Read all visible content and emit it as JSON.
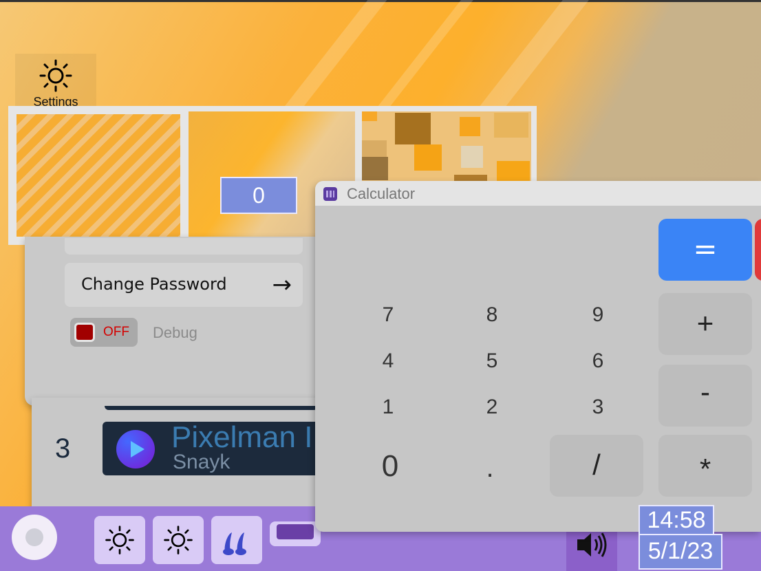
{
  "desktop": {
    "icons": [
      {
        "label": "Settings",
        "icon": "sun-gear-icon"
      }
    ]
  },
  "wallpaper_picker": {
    "counter": "0"
  },
  "settings_window": {
    "change_password_label": "Change Password",
    "change_password_arrow": "→",
    "debug_toggle_state": "OFF",
    "debug_label": "Debug"
  },
  "music_window": {
    "track_number": "3",
    "track_title": "Pixelman I",
    "track_artist": "Snayk"
  },
  "calculator": {
    "title": "Calculator",
    "keys": {
      "equals": "=",
      "plus": "+",
      "minus": "-",
      "multiply": "*",
      "divide": "/",
      "decimal": ".",
      "zero": "0",
      "one": "1",
      "two": "2",
      "three": "3",
      "four": "4",
      "five": "5",
      "six": "6",
      "seven": "7",
      "eight": "8",
      "nine": "9"
    },
    "colors": {
      "equals": "#3a84f6",
      "clear": "#e03a3a"
    }
  },
  "taskbar": {
    "apps": [
      "sun-gear-icon",
      "sun-gear-icon",
      "music-notes-icon",
      "calculator-icon"
    ],
    "time": "14:58",
    "date": "5/1/23",
    "color": "#9a7ad8"
  }
}
